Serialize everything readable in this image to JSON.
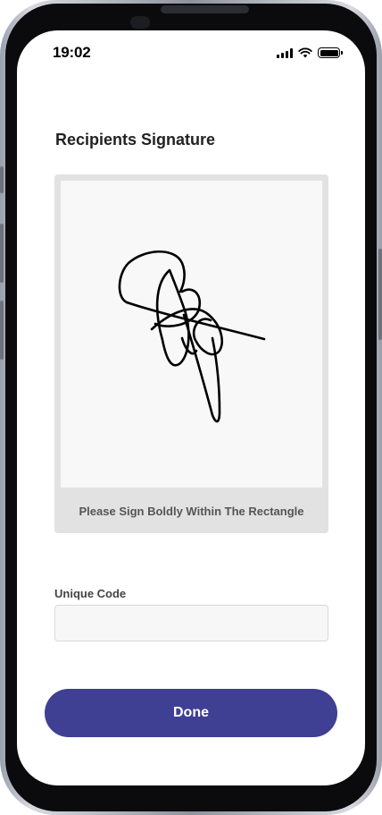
{
  "status_bar": {
    "time": "19:02",
    "icons": [
      "cellular-signal-icon",
      "wifi-icon",
      "battery-icon"
    ]
  },
  "page": {
    "title": "Recipients Signature"
  },
  "signature": {
    "hint": "Please Sign Boldly Within The Rectangle"
  },
  "unique_code": {
    "label": "Unique Code",
    "value": "",
    "placeholder": ""
  },
  "done_button": {
    "label": "Done"
  },
  "colors": {
    "primary": "#3f3f93",
    "signature_frame": "#e2e2e2",
    "canvas": "#f8f8f8",
    "ink": "#000000"
  }
}
